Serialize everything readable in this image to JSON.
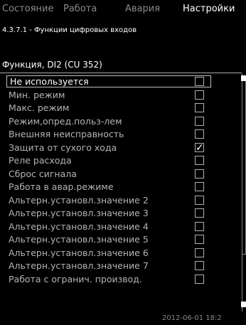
{
  "tabs": [
    {
      "label": "Состояние",
      "active": false
    },
    {
      "label": "Работа",
      "active": false
    },
    {
      "label": "Авария",
      "active": false
    },
    {
      "label": "Настройки",
      "active": true
    }
  ],
  "breadcrumb": "4.3.7.1 - Функции цифровых входов",
  "section_title": "Функция, DI2 (CU 352)",
  "options": [
    {
      "label": "Не используется",
      "checked": false,
      "selected": true
    },
    {
      "label": "Мин. режим",
      "checked": false
    },
    {
      "label": "Макс. режим",
      "checked": false
    },
    {
      "label": "Режим,опред.польз-лем",
      "checked": false
    },
    {
      "label": "Внешняя неисправность",
      "checked": false
    },
    {
      "label": "Защита от сухого хода",
      "checked": true
    },
    {
      "label": "Реле расхода",
      "checked": false
    },
    {
      "label": "Сброс сигнала",
      "checked": false
    },
    {
      "label": "Работа в авар.режиме",
      "checked": false
    },
    {
      "label": "Альтерн.установл.значение 2",
      "checked": false
    },
    {
      "label": "Альтерн.установл.значение 3",
      "checked": false
    },
    {
      "label": "Альтерн.установл.значение 4",
      "checked": false
    },
    {
      "label": "Альтерн.установл.значение 5",
      "checked": false
    },
    {
      "label": "Альтерн.установл.значение 6",
      "checked": false
    },
    {
      "label": "Альтерн.установл.значение 7",
      "checked": false
    },
    {
      "label": "Работа с огранич. производ.",
      "checked": false
    }
  ],
  "check_glyph": "✓",
  "timestamp": "2012-06-01 18:2"
}
